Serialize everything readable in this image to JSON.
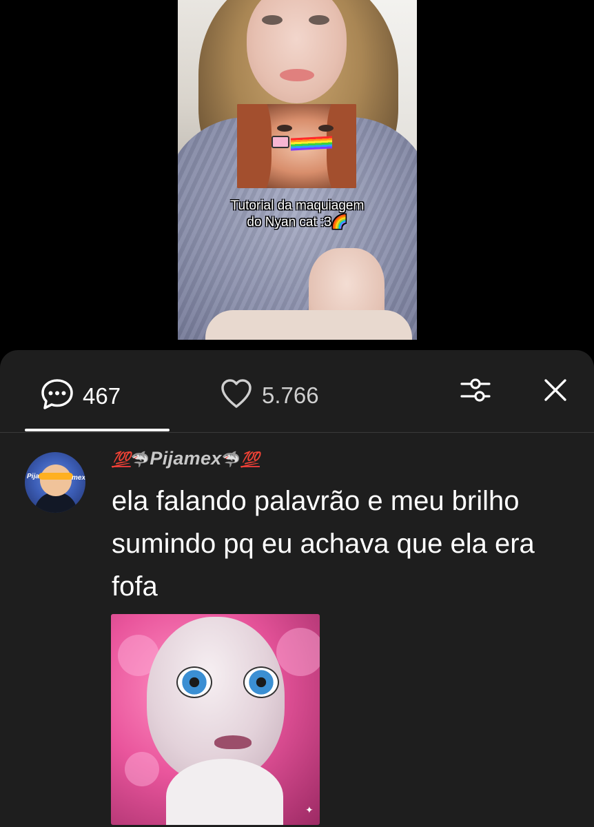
{
  "video": {
    "caption_line1": "Tutorial da maquiagem",
    "caption_line2": "do Nyan cat :3",
    "caption_emoji": "🌈"
  },
  "sheet": {
    "comments_count": "467",
    "likes_count": "5.766",
    "icons": {
      "comments": "comment-bubble-icon",
      "likes": "heart-icon",
      "filter": "filter-sliders-icon",
      "close": "close-icon"
    }
  },
  "comment": {
    "username_prefix": "💯",
    "username_shark_left": "🦈",
    "username": "Pijamex",
    "username_shark_right": "🦈",
    "username_suffix": "💯",
    "text": "ela falando palavrão e meu brilho sumindo pq eu achava que ela era fofa",
    "avatar_text_left": "Pija",
    "avatar_text_right": "mex"
  },
  "colors": {
    "sheet_bg": "#1e1e1e",
    "page_bg": "#000000",
    "muted_text": "#cfcfcf",
    "accent_red": "#e23a3a"
  }
}
